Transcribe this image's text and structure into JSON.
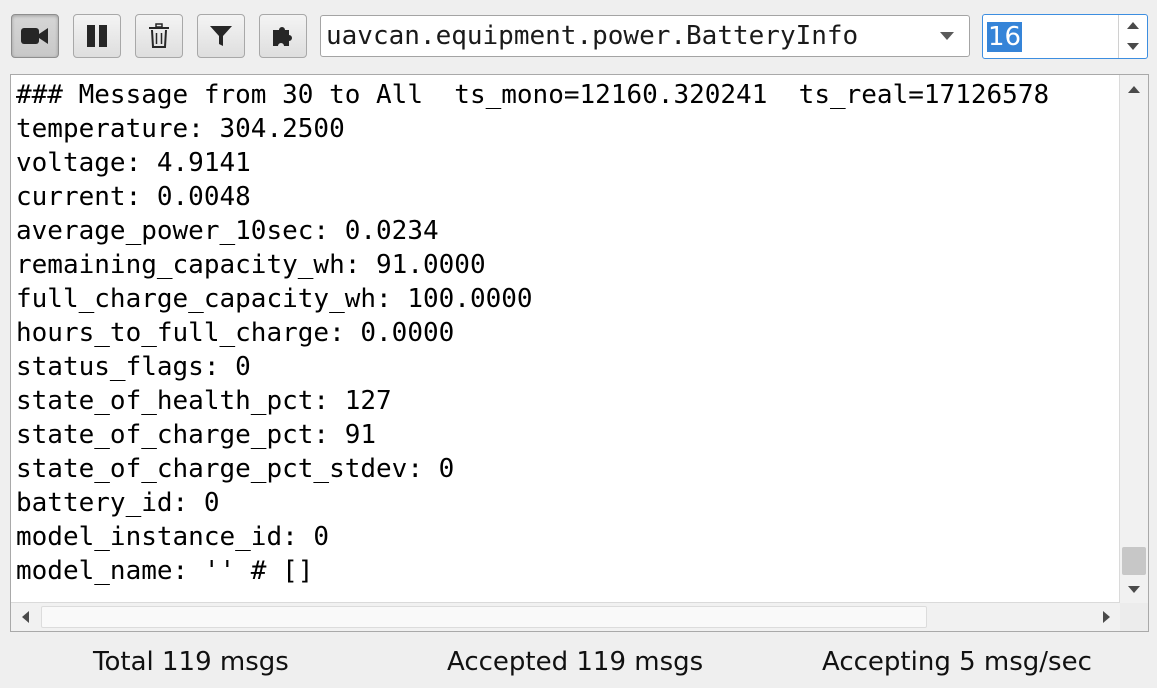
{
  "toolbar": {
    "buttons": [
      {
        "icon": "camera-icon",
        "state": "active"
      },
      {
        "icon": "pause-icon"
      },
      {
        "icon": "trash-icon"
      },
      {
        "icon": "filter-icon"
      },
      {
        "icon": "puzzle-icon"
      }
    ],
    "message_type": "uavcan.equipment.power.BatteryInfo",
    "message_type_icon": "chevron-down-icon",
    "count_value": "16"
  },
  "message": {
    "lines": [
      "### Message from 30 to All  ts_mono=12160.320241  ts_real=17126578",
      "temperature: 304.2500",
      "voltage: 4.9141",
      "current: 0.0048",
      "average_power_10sec: 0.0234",
      "remaining_capacity_wh: 91.0000",
      "full_charge_capacity_wh: 100.0000",
      "hours_to_full_charge: 0.0000",
      "status_flags: 0",
      "state_of_health_pct: 127",
      "state_of_charge_pct: 91",
      "state_of_charge_pct_stdev: 0",
      "battery_id: 0",
      "model_instance_id: 0",
      "model_name: '' # []"
    ]
  },
  "status": {
    "total": "Total 119 msgs",
    "accepted": "Accepted 119 msgs",
    "rate": "Accepting 5 msg/sec"
  },
  "colors": {
    "selection": "#3584d8",
    "focus_border": "#3d8ee0",
    "background": "#efefef"
  }
}
